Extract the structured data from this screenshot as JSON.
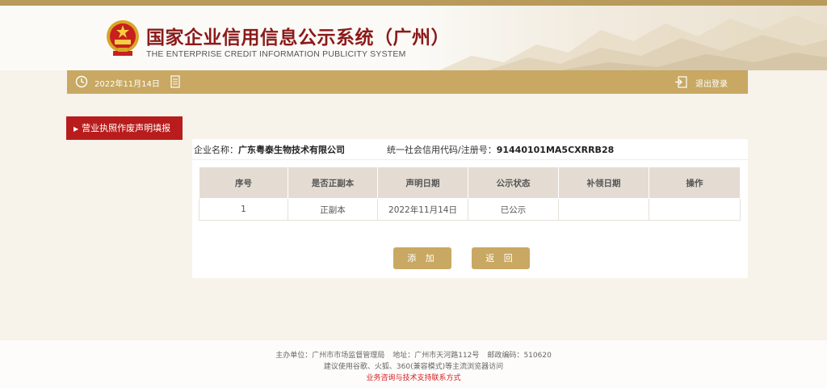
{
  "header": {
    "title": "国家企业信用信息公示系统（广州）",
    "subtitle": "THE ENTERPRISE CREDIT INFORMATION PUBLICITY SYSTEM"
  },
  "nav": {
    "date": "2022年11月14日",
    "logout_label": "退出登录"
  },
  "sidebar": {
    "items": [
      {
        "label": "营业执照作废声明填报"
      }
    ]
  },
  "company": {
    "name_label": "企业名称：",
    "name": "广东粤泰生物技术有限公司",
    "credit_label": "统一社会信用代码/注册号：",
    "credit_code": "91440101MA5CXRRB28"
  },
  "table": {
    "columns": [
      "序号",
      "是否正副本",
      "声明日期",
      "公示状态",
      "补领日期",
      "操作"
    ],
    "rows": [
      [
        "1",
        "正副本",
        "2022年11月14日",
        "已公示",
        "",
        ""
      ]
    ]
  },
  "buttons": {
    "add": "添 加",
    "back": "返 回"
  },
  "footer": {
    "host_label": "主办单位：",
    "host": "广州市市场监督管理局",
    "address_label": "地址：",
    "address": "广州市天河路112号",
    "postcode_label": "邮政编码：",
    "postcode": "510620",
    "browser_note": "建议使用谷歌、火狐、360(兼容模式)等主流浏览器访问",
    "support_link": "业务咨询与技术支持联系方式"
  },
  "colors": {
    "accent_gold": "#c8a862",
    "sidebar_red": "#b81c1c",
    "title_red": "#8b1a1a"
  }
}
